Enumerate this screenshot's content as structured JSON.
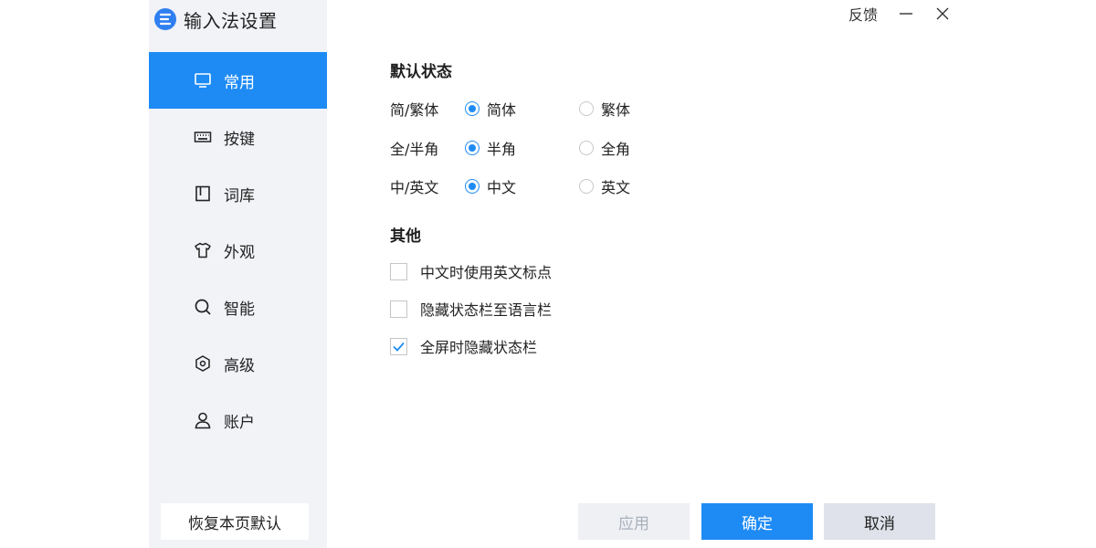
{
  "app": {
    "title": "输入法设置"
  },
  "topbar": {
    "feedback": "反馈"
  },
  "sidebar": {
    "items": [
      {
        "label": "常用",
        "icon": "monitor-icon",
        "active": true
      },
      {
        "label": "按键",
        "icon": "keyboard-icon",
        "active": false
      },
      {
        "label": "词库",
        "icon": "book-icon",
        "active": false
      },
      {
        "label": "外观",
        "icon": "shirt-icon",
        "active": false
      },
      {
        "label": "智能",
        "icon": "search-icon",
        "active": false
      },
      {
        "label": "高级",
        "icon": "hexagon-settings-icon",
        "active": false
      },
      {
        "label": "账户",
        "icon": "user-icon",
        "active": false
      }
    ],
    "restore_label": "恢复本页默认"
  },
  "main": {
    "default_state": {
      "title": "默认状态",
      "rows": [
        {
          "label": "简/繁体",
          "options": [
            "简体",
            "繁体"
          ],
          "selected": "简体"
        },
        {
          "label": "全/半角",
          "options": [
            "半角",
            "全角"
          ],
          "selected": "半角"
        },
        {
          "label": "中/英文",
          "options": [
            "中文",
            "英文"
          ],
          "selected": "中文"
        }
      ]
    },
    "other": {
      "title": "其他",
      "checkboxes": [
        {
          "label": "中文时使用英文标点",
          "checked": false
        },
        {
          "label": "隐藏状态栏至语言栏",
          "checked": false
        },
        {
          "label": "全屏时隐藏状态栏",
          "checked": true
        }
      ]
    }
  },
  "footer": {
    "apply": "应用",
    "ok": "确定",
    "cancel": "取消"
  },
  "colors": {
    "accent": "#1e8bf5",
    "sidebar_bg": "#f1f3f7",
    "disabled_text": "#a9b0bb"
  }
}
